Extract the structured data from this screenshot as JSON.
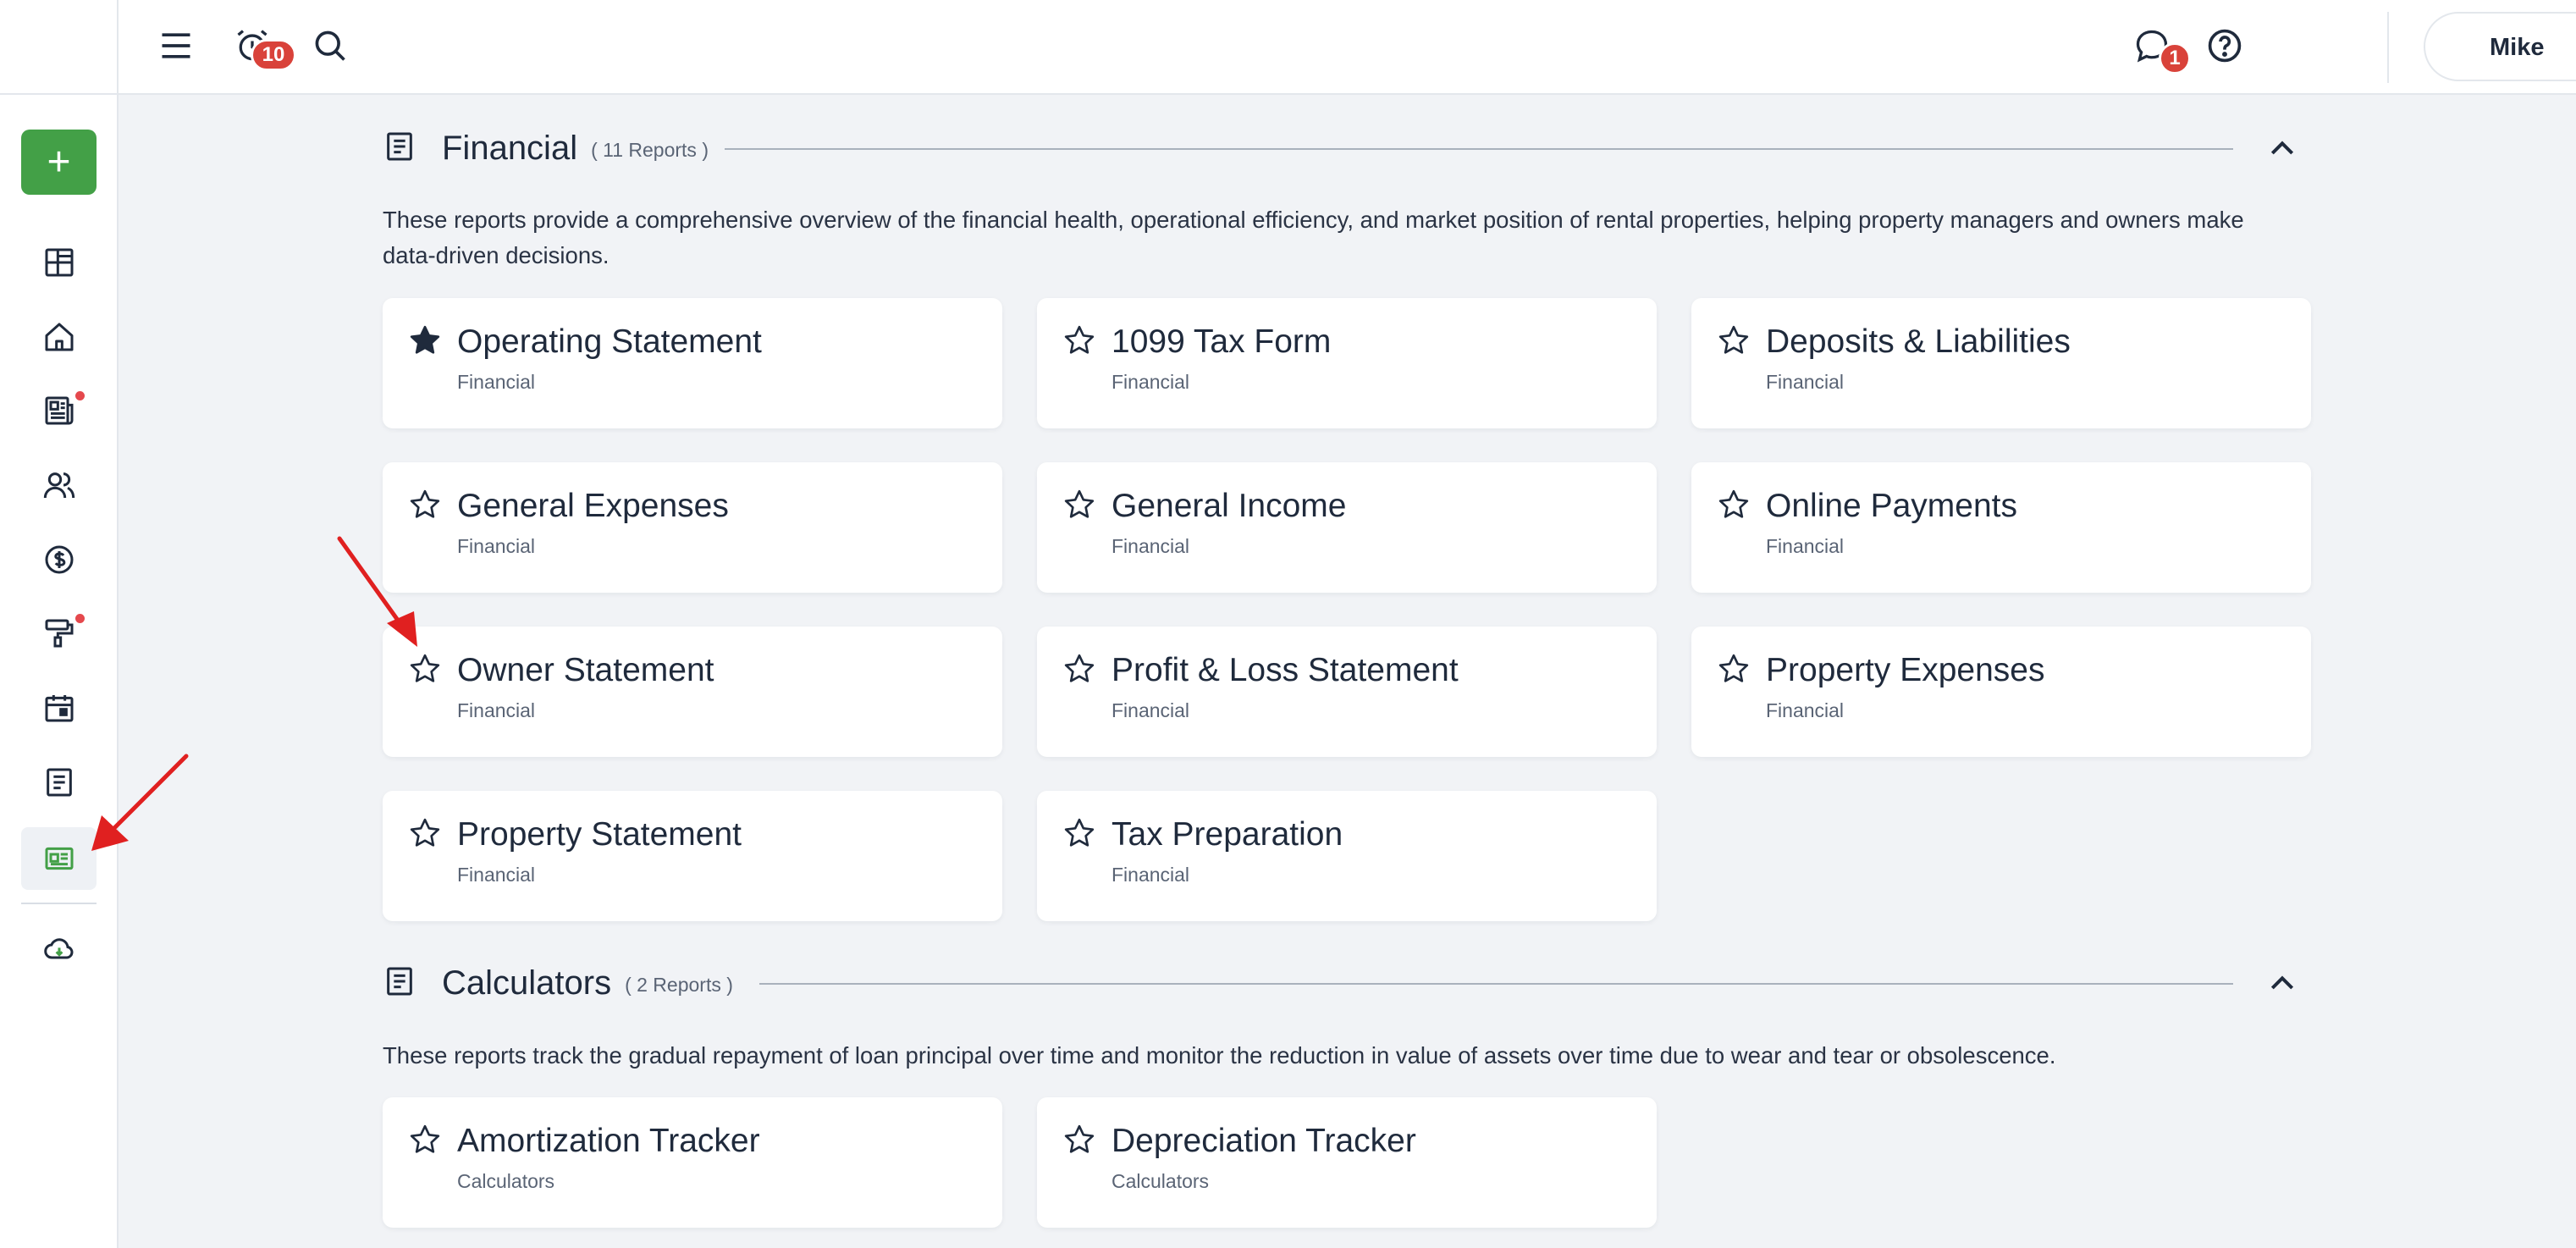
{
  "header": {
    "menu_icon": "hamburger-icon",
    "alarm_icon": "alarm-clock-icon",
    "alarm_badge": "10",
    "search_icon": "search-icon",
    "chat_icon": "chat-bubble-icon",
    "chat_badge": "1",
    "help_icon": "help-circle-icon",
    "user_name": "Mike"
  },
  "sidebar": {
    "add_label": "+",
    "items": [
      {
        "icon": "dashboard-icon"
      },
      {
        "icon": "home-icon"
      },
      {
        "icon": "newspaper-icon"
      },
      {
        "icon": "people-icon"
      },
      {
        "icon": "dollar-circle-icon"
      },
      {
        "icon": "paint-roller-icon"
      },
      {
        "icon": "calendar-icon"
      },
      {
        "icon": "document-icon"
      },
      {
        "icon": "reports-icon"
      },
      {
        "icon": "cloud-download-icon"
      }
    ]
  },
  "sections": [
    {
      "title": "Financial",
      "count": "( 11 Reports )",
      "description": "These reports provide a comprehensive overview of the financial health, operational efficiency, and market position of rental properties, helping property managers and owners make data-driven decisions.",
      "cards": [
        {
          "title": "Operating Statement",
          "category": "Financial",
          "favorite": true
        },
        {
          "title": "1099 Tax Form",
          "category": "Financial",
          "favorite": false
        },
        {
          "title": "Deposits & Liabilities",
          "category": "Financial",
          "favorite": false
        },
        {
          "title": "General Expenses",
          "category": "Financial",
          "favorite": false
        },
        {
          "title": "General Income",
          "category": "Financial",
          "favorite": false
        },
        {
          "title": "Online Payments",
          "category": "Financial",
          "favorite": false
        },
        {
          "title": "Owner Statement",
          "category": "Financial",
          "favorite": false
        },
        {
          "title": "Profit & Loss Statement",
          "category": "Financial",
          "favorite": false
        },
        {
          "title": "Property Expenses",
          "category": "Financial",
          "favorite": false
        },
        {
          "title": "Property Statement",
          "category": "Financial",
          "favorite": false
        },
        {
          "title": "Tax Preparation",
          "category": "Financial",
          "favorite": false
        }
      ]
    },
    {
      "title": "Calculators",
      "count": "( 2 Reports )",
      "description": "These reports track the gradual repayment of loan principal over time and monitor the reduction in value of assets over time due to wear and tear or obsolescence.",
      "cards": [
        {
          "title": "Amortization Tracker",
          "category": "Calculators",
          "favorite": false
        },
        {
          "title": "Depreciation Tracker",
          "category": "Calculators",
          "favorite": false
        }
      ]
    }
  ],
  "colors": {
    "accent_green": "#43a047",
    "badge_red": "#d9423a",
    "annotation_arrow": "#e02020"
  }
}
